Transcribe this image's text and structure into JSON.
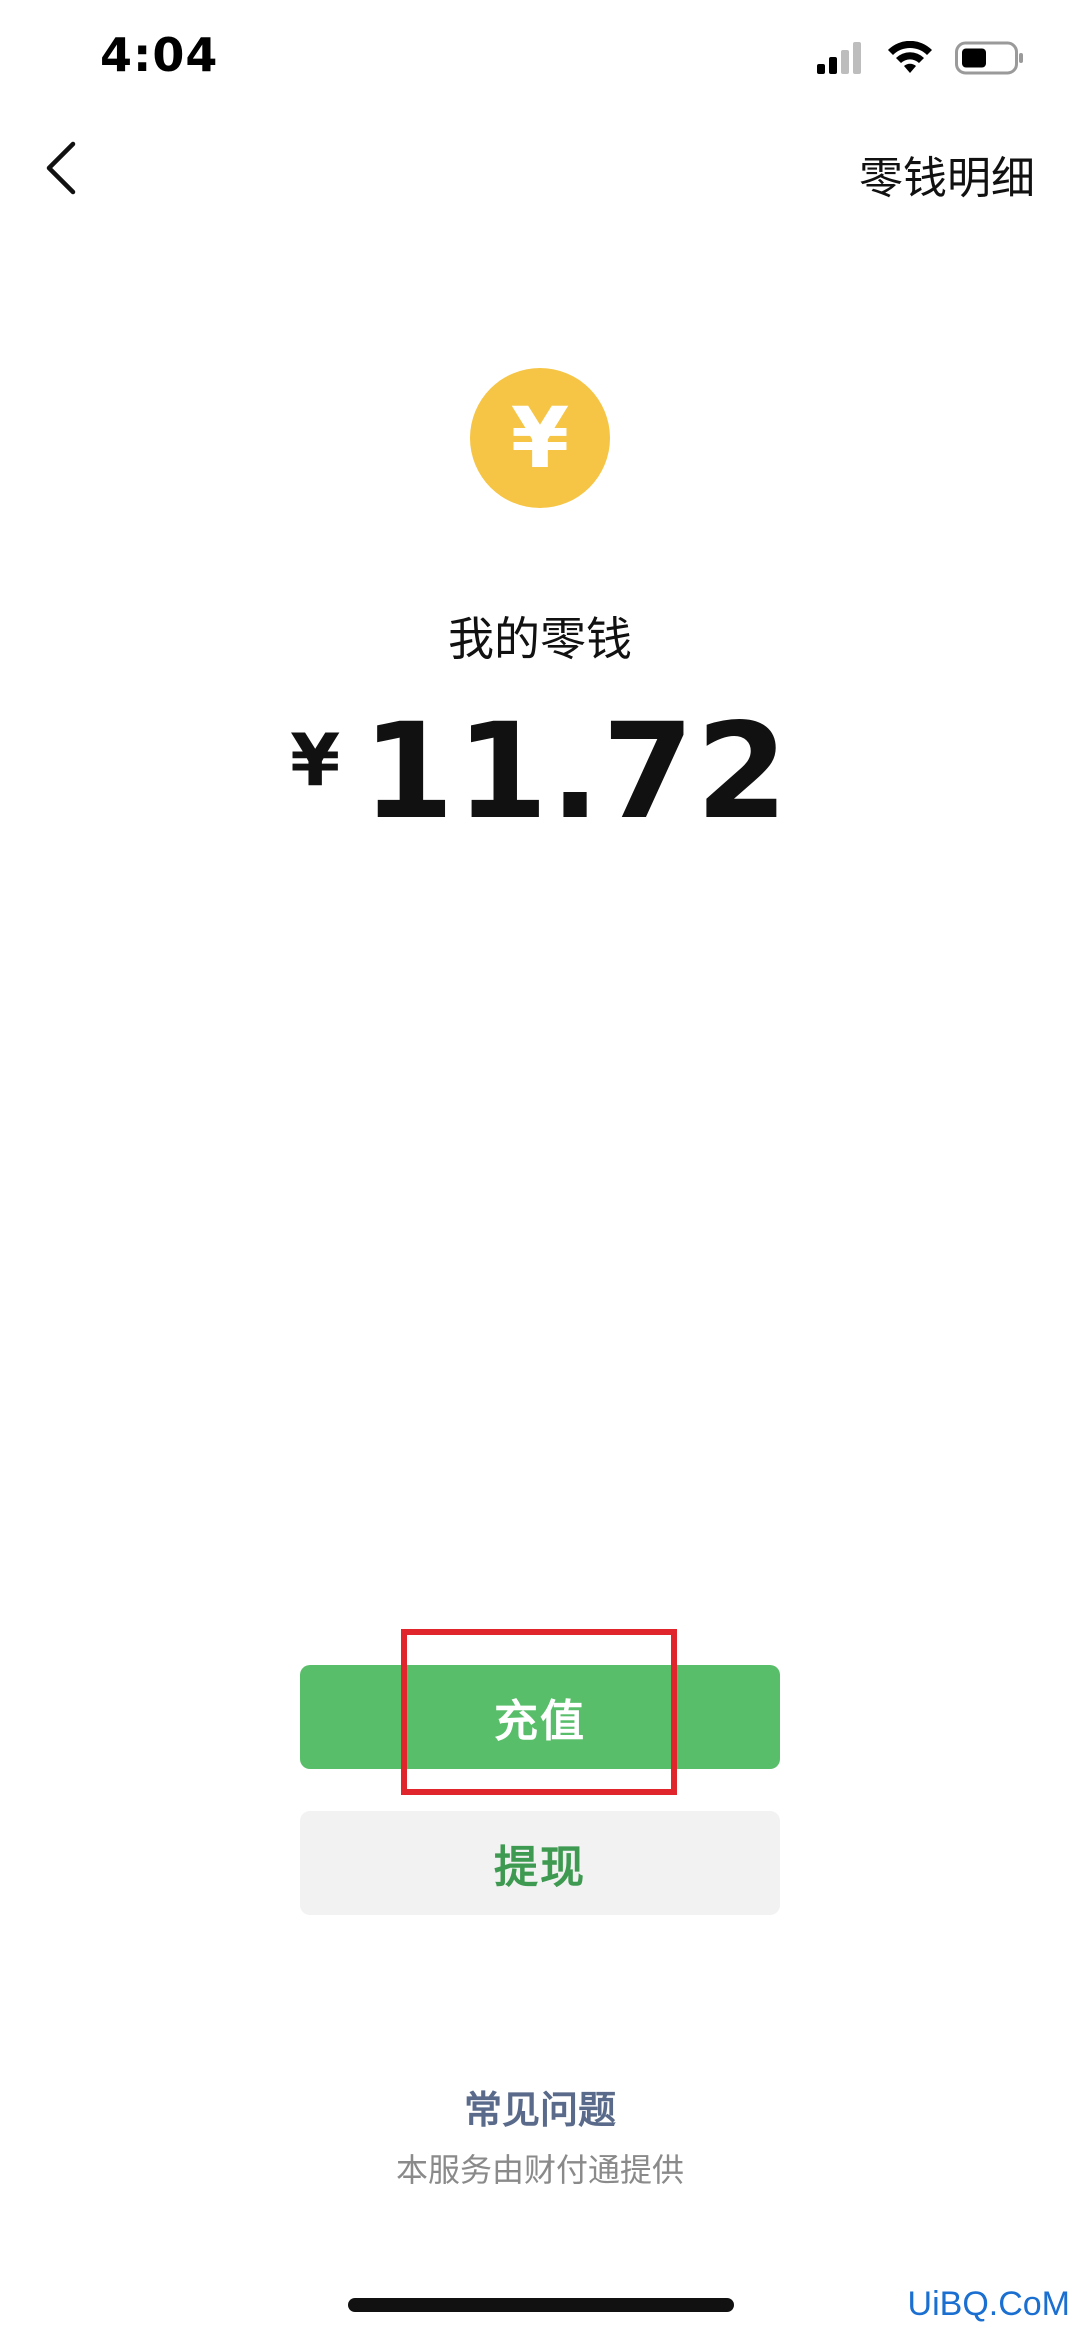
{
  "status_bar": {
    "time": "4:04",
    "icons": [
      "signal-icon",
      "wifi-icon",
      "battery-icon"
    ]
  },
  "nav": {
    "back_icon": "chevron-left-icon",
    "details_link": "零钱明细"
  },
  "wallet": {
    "coin_symbol": "¥",
    "label": "我的零钱",
    "currency": "¥",
    "amount": "11.72"
  },
  "actions": {
    "recharge_label": "充值",
    "withdraw_label": "提现"
  },
  "footer": {
    "faq_label": "常见问题",
    "provider_note": "本服务由财付通提供"
  },
  "watermark": "UiBQ.CoM",
  "colors": {
    "coin": "#F6C545",
    "primary_green": "#58BE6A",
    "secondary_bg": "#F2F2F2",
    "secondary_text": "#3E9A51",
    "highlight": "#E0262C",
    "faq_text": "#5A6A8A"
  }
}
